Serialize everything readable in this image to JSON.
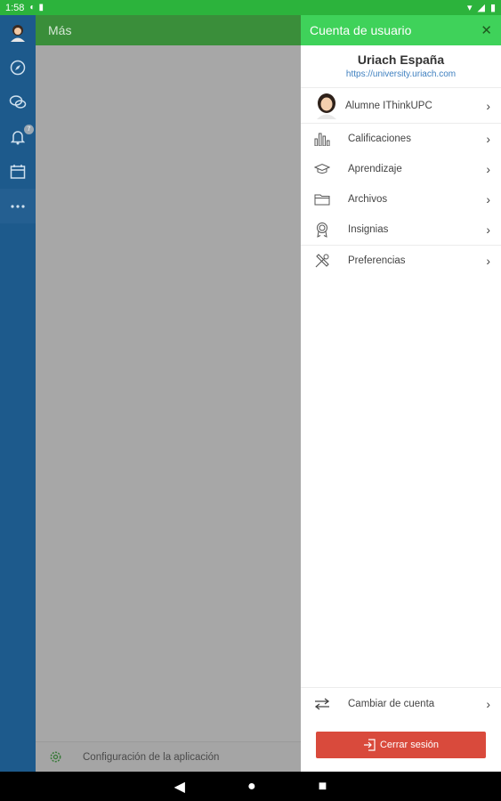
{
  "statusbar": {
    "time": "1:58"
  },
  "rail": {
    "notifications_badge": "7"
  },
  "main": {
    "title": "Más",
    "footer_label": "Configuración de la aplicación"
  },
  "panel": {
    "title": "Cuenta de usuario",
    "site_name": "Uriach España",
    "site_url": "https://university.uriach.com",
    "user_name": "Alumne IThinkUPC",
    "menu": [
      {
        "label": "Calificaciones",
        "icon": "bar-chart-icon"
      },
      {
        "label": "Aprendizaje",
        "icon": "graduation-cap-icon"
      },
      {
        "label": "Archivos",
        "icon": "folder-icon"
      },
      {
        "label": "Insignias",
        "icon": "badge-icon"
      },
      {
        "label": "Preferencias",
        "icon": "tools-icon"
      }
    ],
    "switch_account": "Cambiar de cuenta",
    "logout": "Cerrar sesión"
  },
  "colors": {
    "statusbar": "#2cb33c",
    "rail": "#1d5a8c",
    "panel_header": "#3fd25a",
    "logout": "#d94a3c",
    "link": "#3d7fbf"
  }
}
